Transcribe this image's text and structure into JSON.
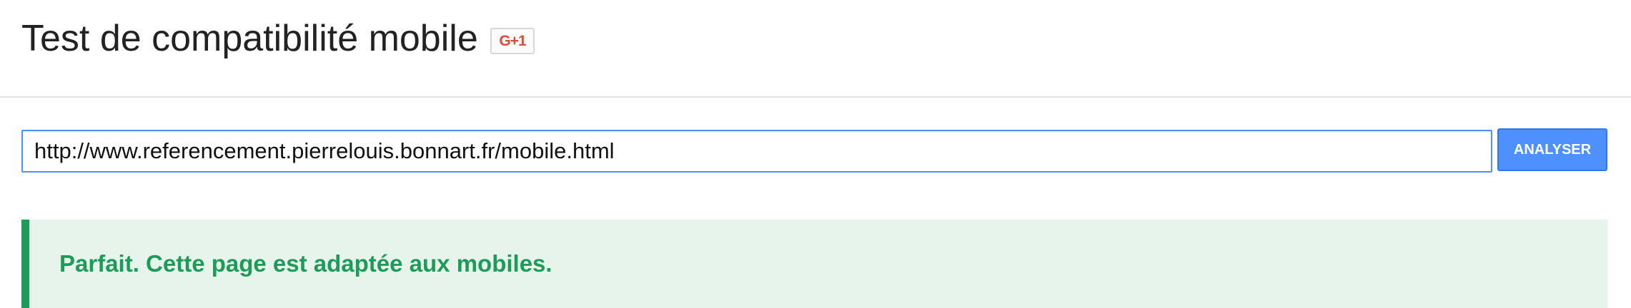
{
  "header": {
    "title": "Test de compatibilité mobile",
    "gplus_label": "G+1"
  },
  "form": {
    "url_value": "http://www.referencement.pierrelouis.bonnart.fr/mobile.html",
    "analyse_label": "ANALYSER"
  },
  "result": {
    "message": "Parfait. Cette page est adaptée aux mobiles.",
    "status_color": "#1e9b58",
    "background_color": "#e6f4ec"
  },
  "colors": {
    "accent": "#4d90fe",
    "gplus": "#dd4b39"
  }
}
